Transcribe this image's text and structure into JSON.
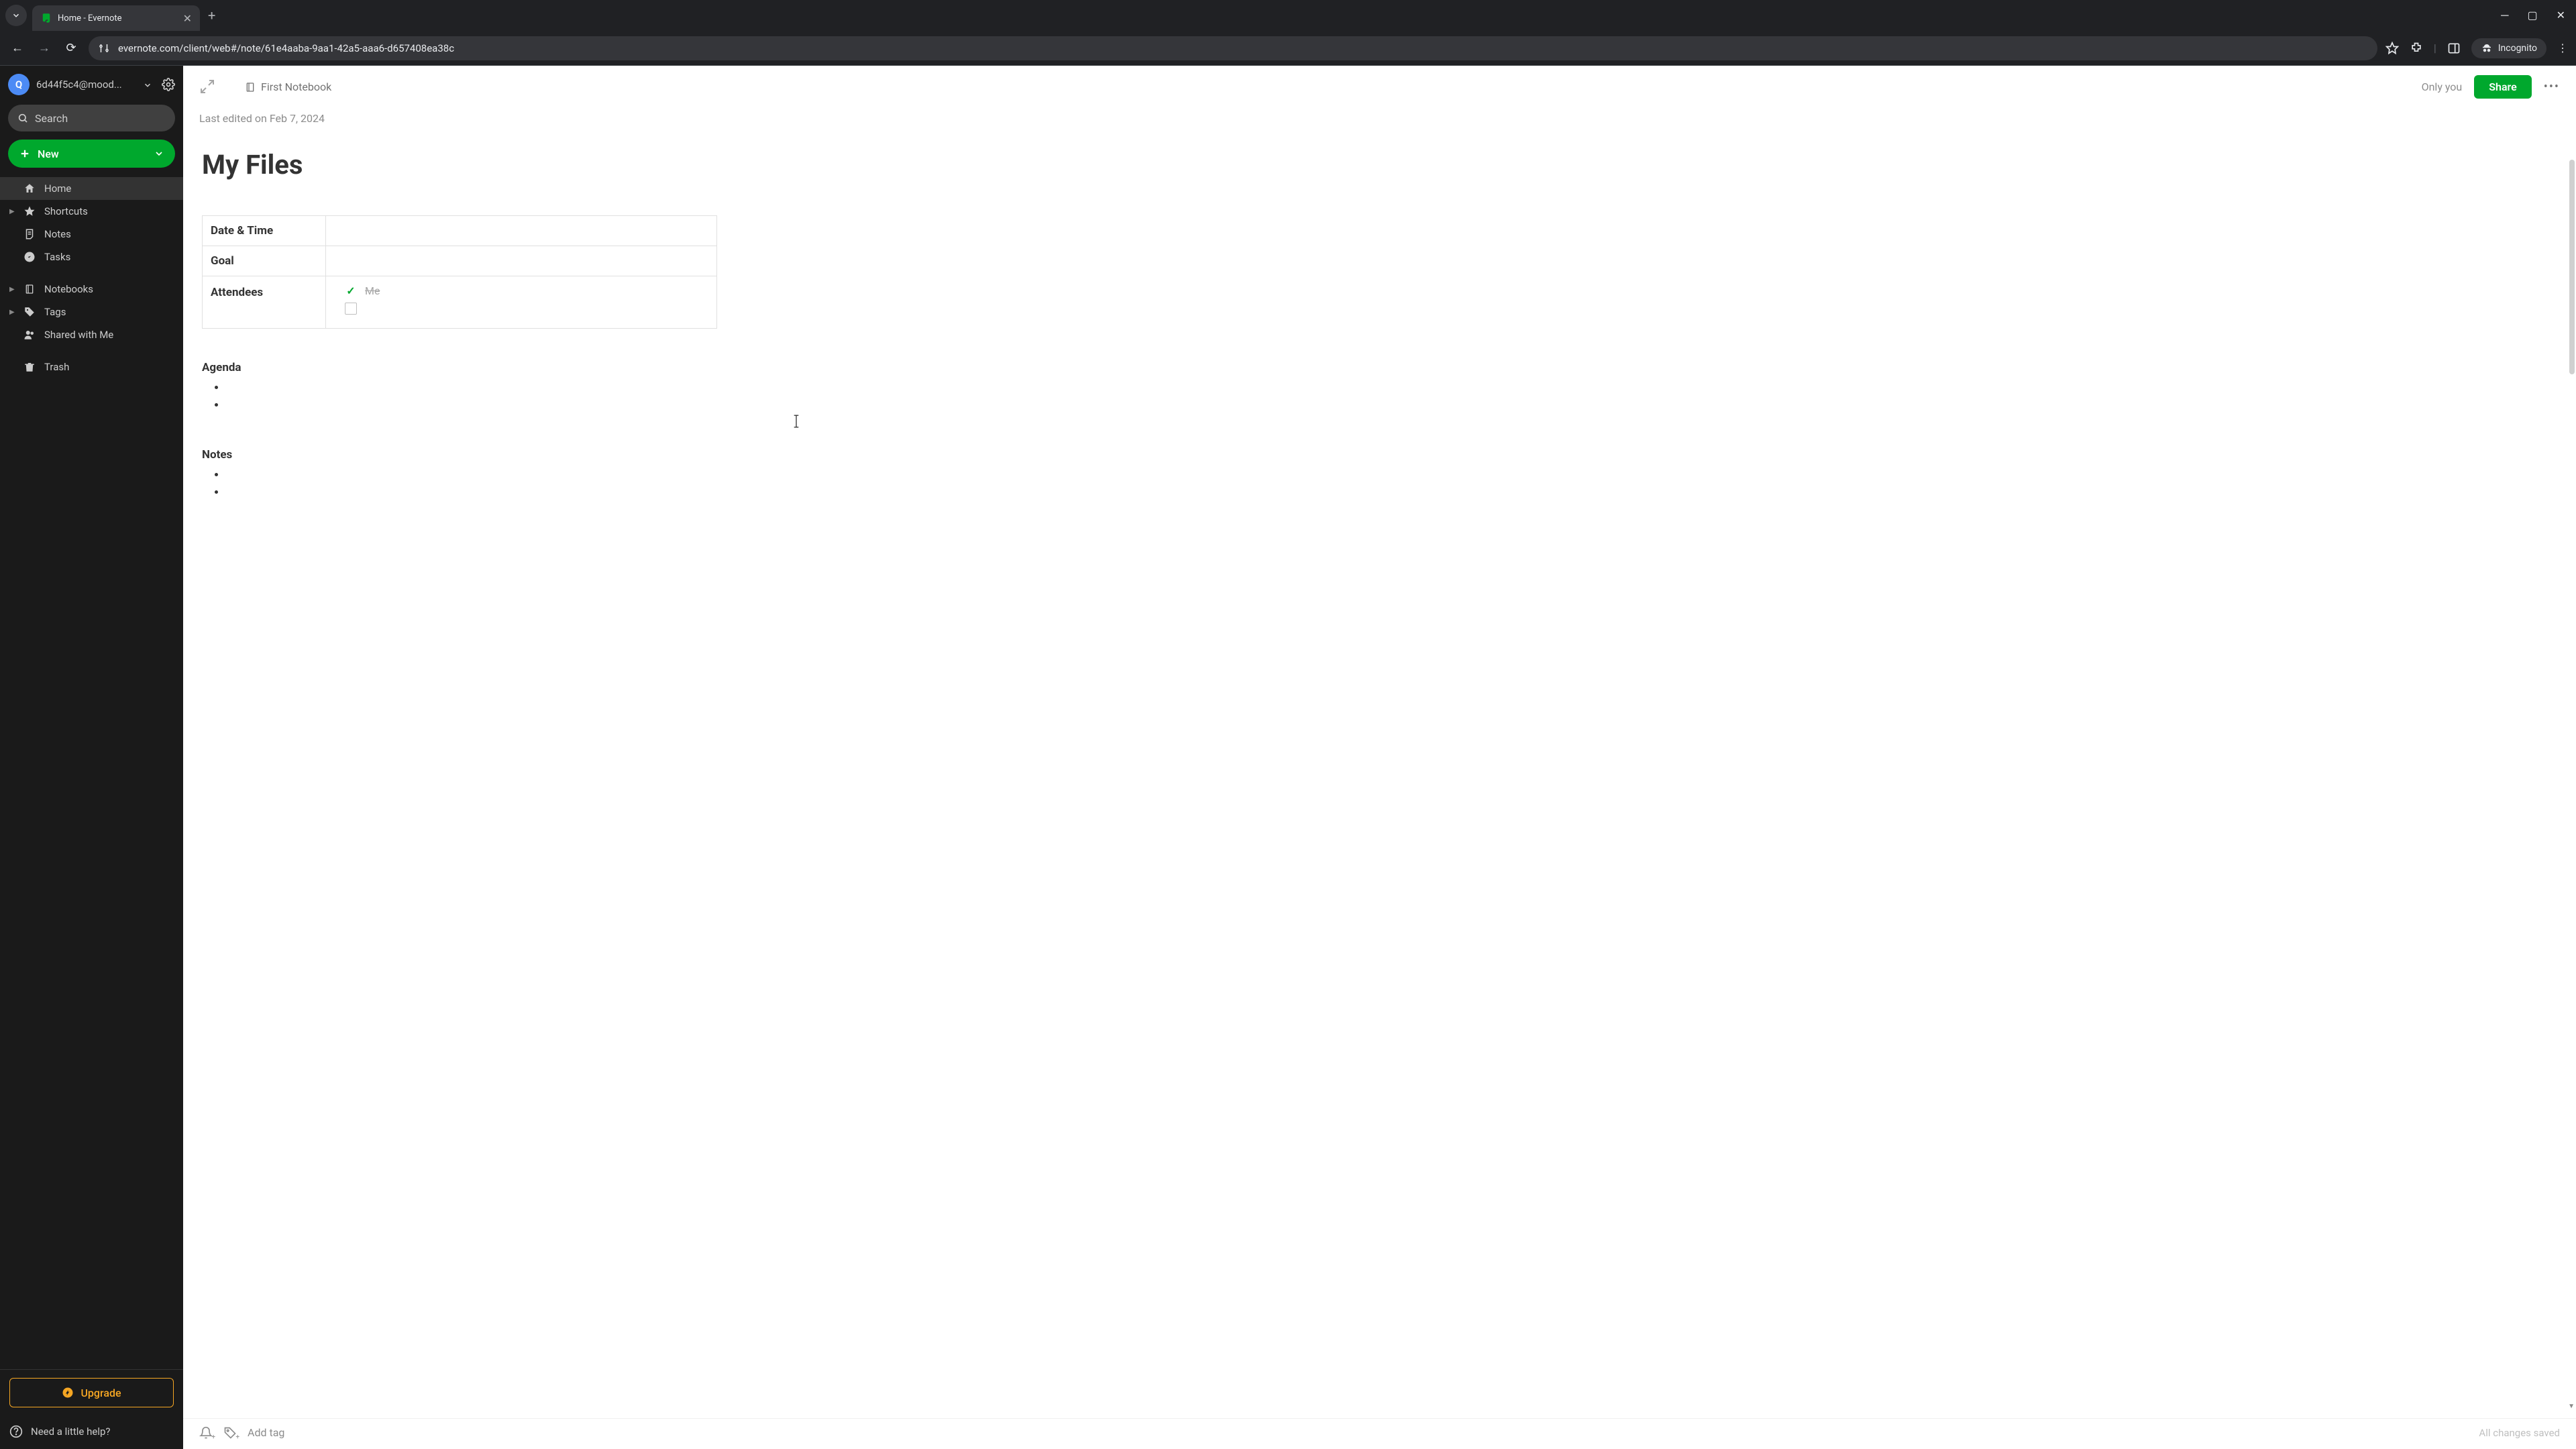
{
  "browser": {
    "tab_title": "Home - Evernote",
    "url": "evernote.com/client/web#/note/61e4aaba-9aa1-42a5-aaa6-d657408ea38c",
    "incognito_label": "Incognito"
  },
  "sidebar": {
    "account": {
      "avatar_letter": "Q",
      "email": "6d44f5c4@mood..."
    },
    "search_placeholder": "Search",
    "new_button": "New",
    "nav": {
      "home": "Home",
      "shortcuts": "Shortcuts",
      "notes": "Notes",
      "tasks": "Tasks",
      "notebooks": "Notebooks",
      "tags": "Tags",
      "shared": "Shared with Me",
      "trash": "Trash"
    },
    "upgrade": "Upgrade",
    "help": "Need a little help?"
  },
  "note": {
    "notebook": "First Notebook",
    "only_you": "Only you",
    "share": "Share",
    "last_edited": "Last edited on Feb 7, 2024",
    "title": "My Files",
    "meta": {
      "date_label": "Date & Time",
      "goal_label": "Goal",
      "attendees_label": "Attendees",
      "attendee_me": "Me"
    },
    "sections": {
      "agenda": "Agenda",
      "notes": "Notes"
    },
    "footer": {
      "add_tag": "Add tag",
      "save_status": "All changes saved"
    }
  }
}
